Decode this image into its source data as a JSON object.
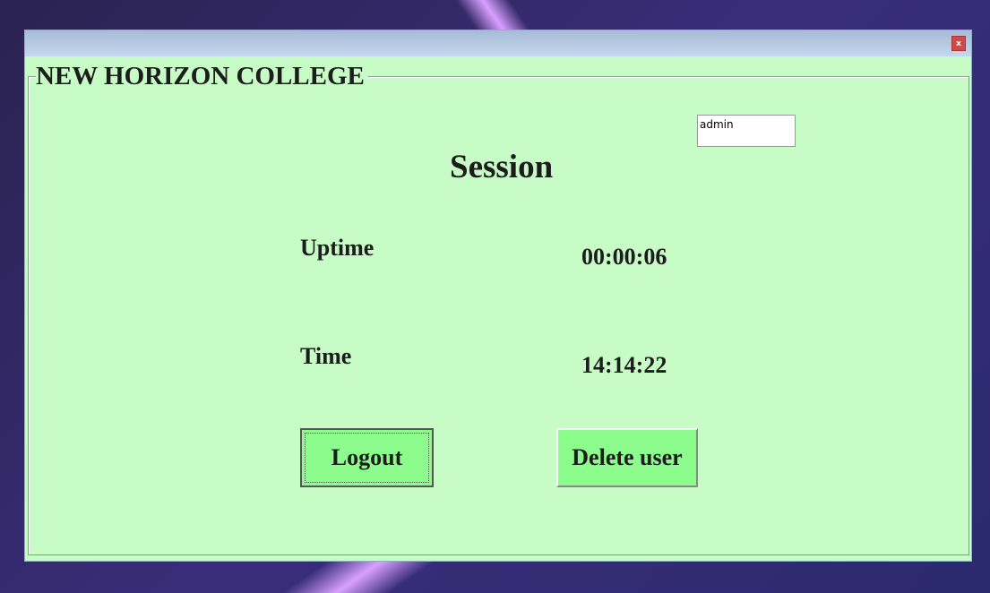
{
  "window": {
    "close_label": "x",
    "title": "NEW HORIZON COLLEGE"
  },
  "user_field": {
    "value": "admin"
  },
  "heading": "Session",
  "uptime": {
    "label": "Uptime",
    "value": "00:00:06"
  },
  "time": {
    "label": "Time",
    "value": "14:14:22"
  },
  "buttons": {
    "logout": "Logout",
    "delete": "Delete user"
  }
}
